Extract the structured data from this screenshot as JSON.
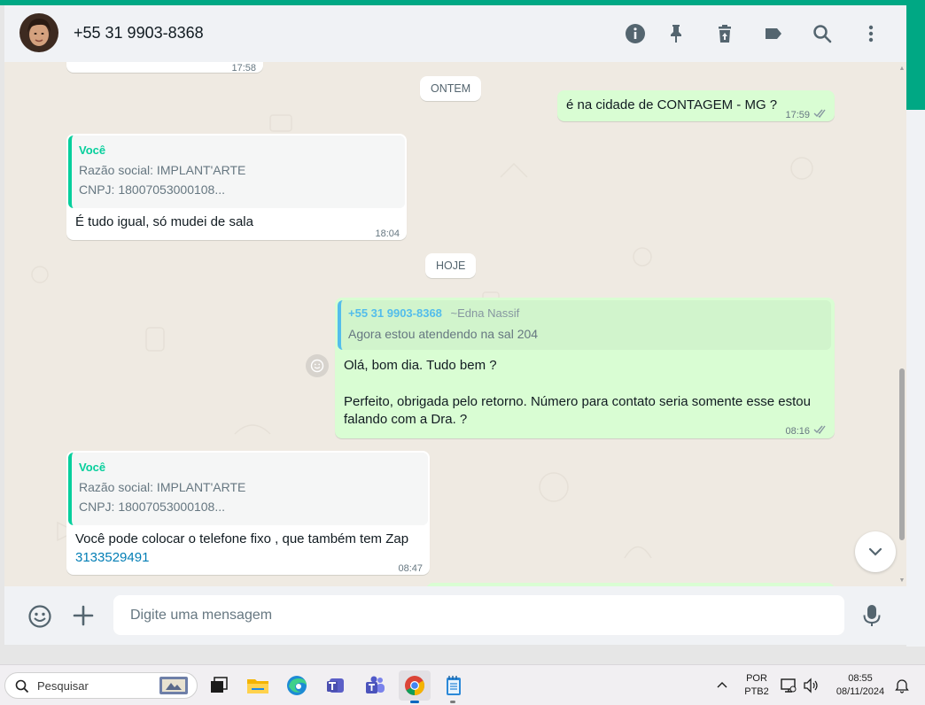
{
  "header": {
    "contact_name": "+55 31 9903-8368",
    "icons": [
      "info-icon",
      "pin-icon",
      "delete-icon",
      "label-icon",
      "search-icon",
      "menu-icon"
    ]
  },
  "date_chips": {
    "yesterday": "ONTEM",
    "today": "HOJE"
  },
  "messages": [
    {
      "id": "m0",
      "direction": "in",
      "time": "17:58",
      "partial": true
    },
    {
      "id": "m1",
      "direction": "out",
      "text": "é na cidade de CONTAGEM - MG ?",
      "time": "17:59",
      "status": "read"
    },
    {
      "id": "m2",
      "direction": "in",
      "quote": {
        "author": "Você",
        "lines": [
          "Razão social: IMPLANT'ARTE",
          "CNPJ: 18007053000108..."
        ]
      },
      "text": "É  tudo igual, só mudei de sala",
      "time": "18:04"
    },
    {
      "id": "m3",
      "direction": "out",
      "quote": {
        "author": "+55 31 9903-8368",
        "author_alias": "~Edna Nassif",
        "lines": [
          "Agora estou atendendo na sal 204"
        ]
      },
      "text_lines": [
        "Olá, bom dia. Tudo bem ?",
        "Perfeito, obrigada pelo retorno. Número para contato seria somente esse estou",
        "falando com a Dra. ?"
      ],
      "time": "08:16",
      "status": "read"
    },
    {
      "id": "m4",
      "direction": "in",
      "quote": {
        "author": "Você",
        "lines": [
          "Razão social: IMPLANT'ARTE",
          "CNPJ: 18007053000108..."
        ]
      },
      "text": "Você pode colocar o telefone fixo , que também tem Zap",
      "link": "3133529491",
      "time": "08:47"
    }
  ],
  "composer": {
    "placeholder": "Digite uma mensagem"
  },
  "taskbar": {
    "search_label": "Pesquisar",
    "language": "POR",
    "keyboard": "PTB2",
    "clock_time": "08:55",
    "clock_date": "08/11/2024"
  },
  "colors": {
    "accent": "#00a884",
    "chat_bg": "#efeae2",
    "outgoing_bubble": "#d9fdd3",
    "incoming_bubble": "#ffffff",
    "read_ticks": "#8696a0"
  }
}
